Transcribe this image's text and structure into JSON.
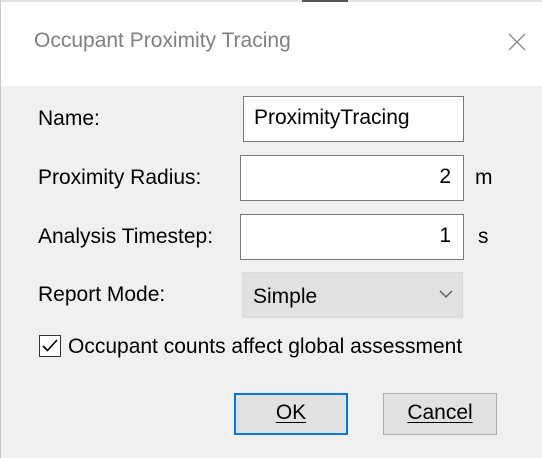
{
  "window": {
    "title": "Occupant Proximity Tracing",
    "close_icon": "close-icon"
  },
  "form": {
    "name": {
      "label": "Name:",
      "value": "ProximityTracing"
    },
    "proximity_radius": {
      "label": "Proximity Radius:",
      "value": "2",
      "unit": "m"
    },
    "analysis_timestep": {
      "label": "Analysis Timestep:",
      "value": "1",
      "unit": "s"
    },
    "report_mode": {
      "label": "Report Mode:",
      "selected": "Simple"
    },
    "global_assessment": {
      "label": "Occupant counts affect global assessment",
      "checked": true
    }
  },
  "buttons": {
    "ok_label": "OK",
    "cancel_label": "Cancel"
  }
}
